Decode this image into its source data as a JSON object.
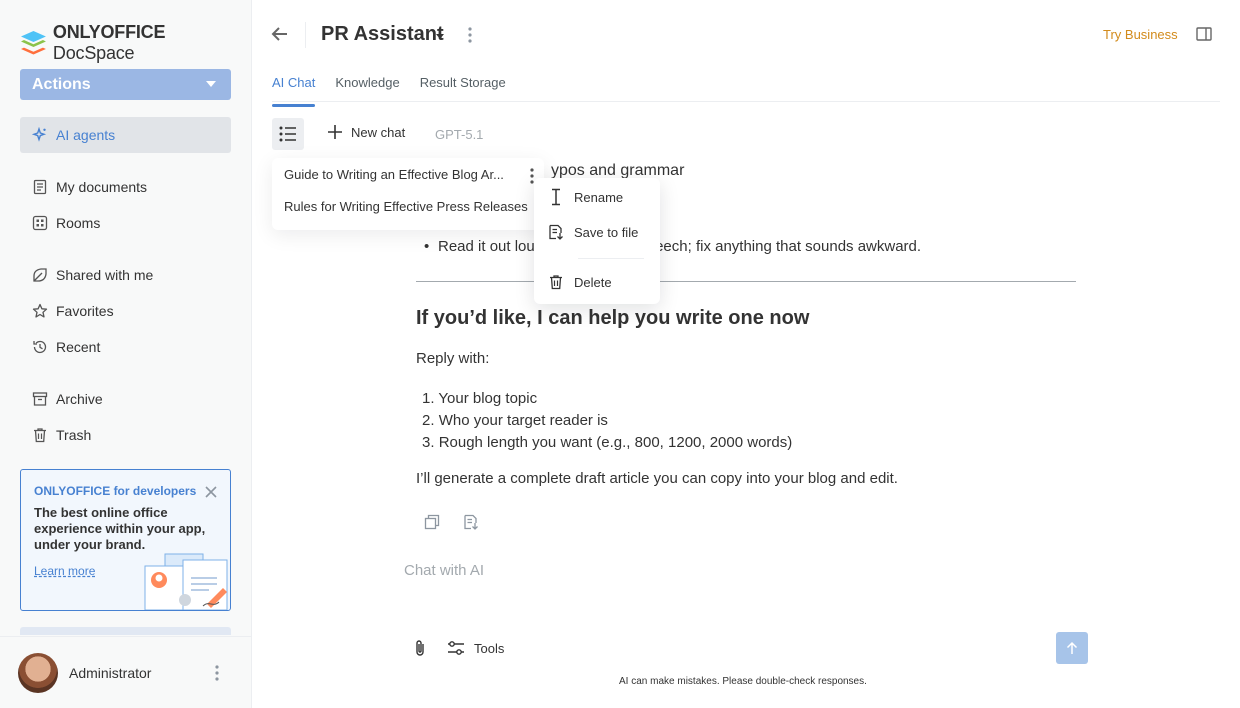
{
  "app": {
    "logo_brand": "ONLYOFFICE",
    "logo_product": "DocSpace"
  },
  "sidebar": {
    "actions_label": "Actions",
    "items": [
      {
        "label": "AI agents",
        "icon": "ai-agents-icon"
      },
      {
        "label": "My documents",
        "icon": "document-icon"
      },
      {
        "label": "Rooms",
        "icon": "rooms-icon"
      },
      {
        "label": "Shared with me",
        "icon": "shared-icon"
      },
      {
        "label": "Favorites",
        "icon": "star-icon"
      },
      {
        "label": "Recent",
        "icon": "recent-icon"
      },
      {
        "label": "Archive",
        "icon": "archive-icon"
      },
      {
        "label": "Trash",
        "icon": "trash-icon"
      }
    ],
    "promo": {
      "title": "ONLYOFFICE for developers",
      "text": "The best online office experience within your app, under your brand.",
      "link": "Learn more"
    },
    "profile": {
      "name": "Administrator"
    }
  },
  "header": {
    "room_title": "PR Assistant",
    "try_business": "Try Business"
  },
  "tabs": [
    {
      "label": "AI Chat",
      "active": true
    },
    {
      "label": "Knowledge",
      "active": false
    },
    {
      "label": "Result Storage",
      "active": false
    }
  ],
  "toolbar": {
    "new_chat": "New chat",
    "model": "GPT-5.1"
  },
  "history": {
    "items": [
      "Guide to Writing an Effective Blog Ar...",
      "Rules for Writing Effective Press Releases"
    ]
  },
  "context_menu": {
    "rename": "Rename",
    "save_to_file": "Save to file",
    "delete": "Delete"
  },
  "chat": {
    "partial_heading": "ypos and grammar",
    "bullet_prefix": "Read it out lou",
    "bullet_suffix": "peech; fix anything that sounds awkward.",
    "heading": "If you’d like, I can help you write one now",
    "reply_with": "Reply with:",
    "list": [
      "Your blog topic",
      "Who your target reader is",
      "Rough length you want (e.g., 800, 1200, 2000 words)"
    ],
    "closing": "I’ll generate a complete draft article you can copy into your blog and edit.",
    "input_placeholder": "Chat with AI",
    "tools_label": "Tools",
    "disclaimer": "AI can make mistakes. Please double-check responses."
  },
  "colors": {
    "accent": "#4781d1",
    "actions_bg": "#9bb7e4",
    "try_business": "#d28b1c",
    "send_bg": "#a7c4e9"
  }
}
